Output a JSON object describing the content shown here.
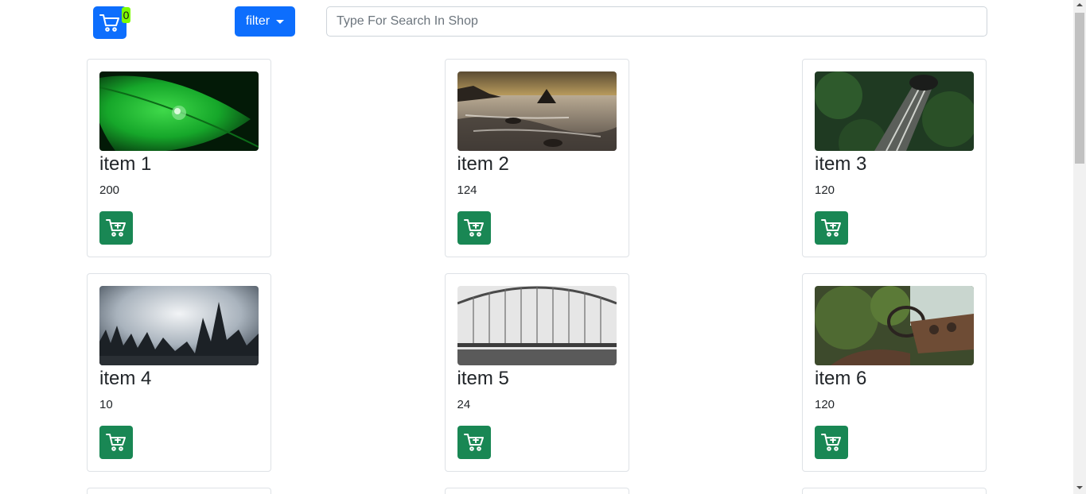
{
  "header": {
    "cart_count": "0",
    "filter_label": "filter",
    "search_placeholder": "Type For Search In Shop",
    "search_value": ""
  },
  "products": [
    {
      "name": "item 1",
      "price": "200"
    },
    {
      "name": "item 2",
      "price": "124"
    },
    {
      "name": "item 3",
      "price": "120"
    },
    {
      "name": "item 4",
      "price": "10"
    },
    {
      "name": "item 5",
      "price": "24"
    },
    {
      "name": "item 6",
      "price": "120"
    }
  ],
  "icons": {
    "cart": "cart-icon",
    "add_to_cart": "cart-plus-icon",
    "filter_caret": "caret-down-icon"
  },
  "colors": {
    "primary": "#0d6efd",
    "success": "#198754",
    "badge": "#7cfc00"
  }
}
